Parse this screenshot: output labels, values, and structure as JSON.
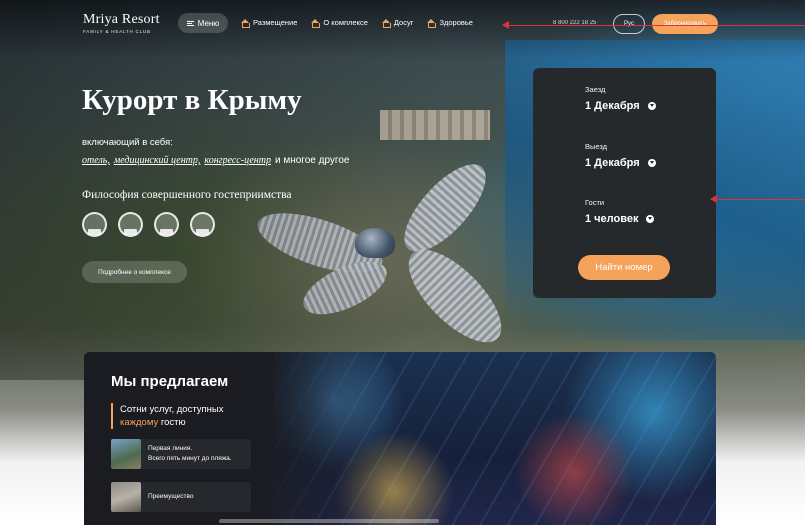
{
  "header": {
    "logo_title": "Mriya Resort",
    "logo_subtitle": "FAMILY & HEALTH CLUB",
    "menu_label": "Меню",
    "nav": [
      {
        "label": "Размещение"
      },
      {
        "label": "О комплексе"
      },
      {
        "label": "Досуг"
      },
      {
        "label": "Здоровье"
      }
    ],
    "phone": "8 800 222 18 25",
    "lang_label": "Рус",
    "book_label": "Забронировать"
  },
  "hero": {
    "title": "Курорт в Крыму",
    "includes": "включающий в себя:",
    "links": [
      "отель,",
      "медицинский центр,",
      "конгресс-центр"
    ],
    "links_tail": "и многое другое",
    "philosophy": "Философия совершенного гостеприимства",
    "about_button": "Подробнее о комплексе"
  },
  "booking": {
    "checkin_label": "Заезд",
    "checkin_value": "1 Декабря",
    "checkout_label": "Выезд",
    "checkout_value": "1 Декабря",
    "guests_label": "Гости",
    "guests_value": "1 человек",
    "find_button": "Найти номер"
  },
  "offer": {
    "title": "Мы предлагаем",
    "subtitle_line1": "Сотни услуг, доступных",
    "subtitle_accent": "каждому",
    "subtitle_tail": "гостю",
    "cards": [
      {
        "line1": "Первая линия.",
        "line2": "Всего пять минут до пляжа."
      },
      {
        "line1": "Преимущество",
        "line2": ""
      }
    ]
  },
  "colors": {
    "accent": "#f5a25a",
    "panel": "#26292c",
    "annotation": "#d9343a"
  }
}
